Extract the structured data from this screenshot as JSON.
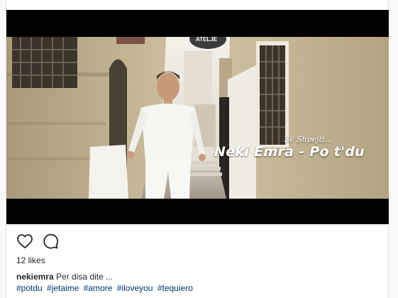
{
  "video": {
    "overlay_small": "Së Shpejti...",
    "overlay_title": "Neki Emra - Po t'du",
    "shop_sign": "ATELJE"
  },
  "actions": {
    "like_icon": "heart-icon",
    "comment_icon": "comment-icon"
  },
  "likes": "12 likes",
  "caption": {
    "username": "nekiemra",
    "text": "Per disa dite ..."
  },
  "hashtags": [
    "#potdu",
    "#jetaime",
    "#amore",
    "#iloveyou",
    "#tequiero"
  ],
  "colors": {
    "hashtag": "#003569",
    "text": "#262626",
    "background": "#fafafa"
  }
}
